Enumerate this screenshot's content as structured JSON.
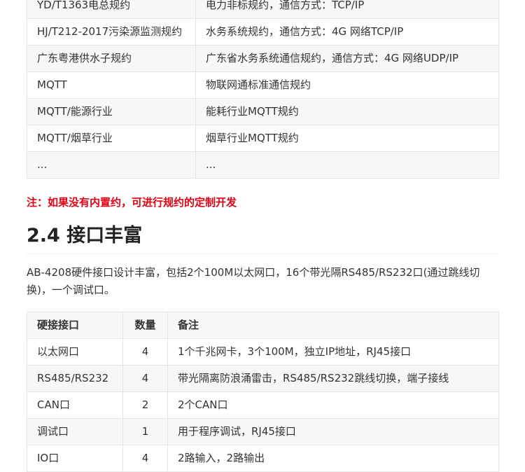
{
  "protocol_table": {
    "rows": [
      {
        "name": "YD/T1363电总规约",
        "desc": "电力非标规约，通信方式：TCP/IP"
      },
      {
        "name": "HJ/T212-2017污染源监测规约",
        "desc": "水务系统规约，通信方式：4G 网络TCP/IP"
      },
      {
        "name": "广东粤港供水子规约",
        "desc": "广东省水务系统通信规约，通信方式：4G 网络UDP/IP"
      },
      {
        "name": "MQTT",
        "desc": "物联网通标准通信规约"
      },
      {
        "name": "MQTT/能源行业",
        "desc": "能耗行业MQTT规约"
      },
      {
        "name": "MQTT/烟草行业",
        "desc": "烟草行业MQTT规约"
      },
      {
        "name": "...",
        "desc": "..."
      }
    ]
  },
  "note": "注：如果没有内置约，可进行规约的定制开发",
  "section": {
    "title": "2.4 接口丰富",
    "paragraph": "AB-4208硬件接口设计丰富，包括2个100M以太网口，16个带光隔RS485/RS232口(通过跳线切换)，一个调试口。"
  },
  "interface_table": {
    "headers": [
      "硬接接口",
      "数量",
      "备注"
    ],
    "rows": [
      {
        "port": "以太网口",
        "count": "4",
        "remark": "1个千兆网卡，3个100M，独立IP地址，RJ45接口"
      },
      {
        "port": "RS485/RS232",
        "count": "4",
        "remark": "带光隔离防浪涌雷击，RS485/RS232跳线切换，端子接线"
      },
      {
        "port": "CAN口",
        "count": "2",
        "remark": "2个CAN口"
      },
      {
        "port": "调试口",
        "count": "1",
        "remark": "用于程序调试，RJ45接口"
      },
      {
        "port": "IO口",
        "count": "4",
        "remark": "2路输入，2路输出"
      }
    ]
  }
}
